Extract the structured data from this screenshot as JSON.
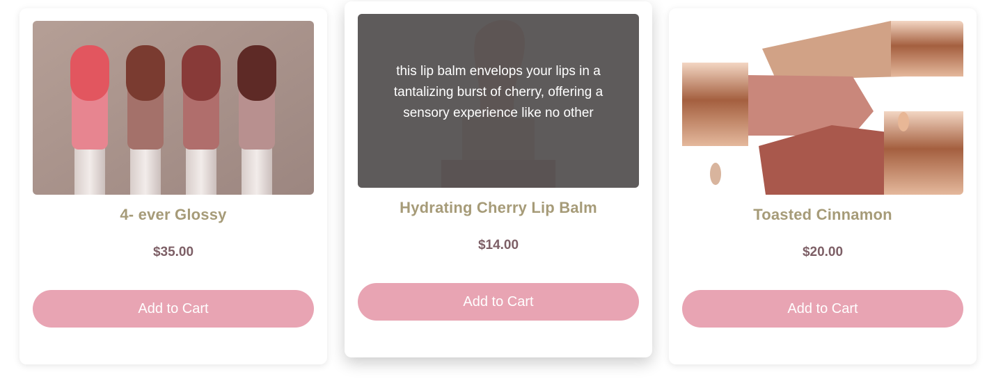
{
  "products": [
    {
      "name": "4- ever Glossy",
      "price": "$35.00",
      "cta": "Add to Cart",
      "image_icon": "lip-gloss-wands-image"
    },
    {
      "name": "Hydrating Cherry Lip Balm",
      "price": "$14.00",
      "cta": "Add to Cart",
      "image_icon": "lip-balm-image",
      "hover_description": "this lip balm envelops your lips in a tantalizing burst of cherry, offering a sensory experience like no other"
    },
    {
      "name": "Toasted Cinnamon",
      "price": "$20.00",
      "cta": "Add to Cart",
      "image_icon": "lipsticks-image"
    }
  ],
  "colors": {
    "product_name": "#a69b78",
    "price": "#7d5f66",
    "button": "#e8a4b3",
    "overlay": "#505050"
  }
}
